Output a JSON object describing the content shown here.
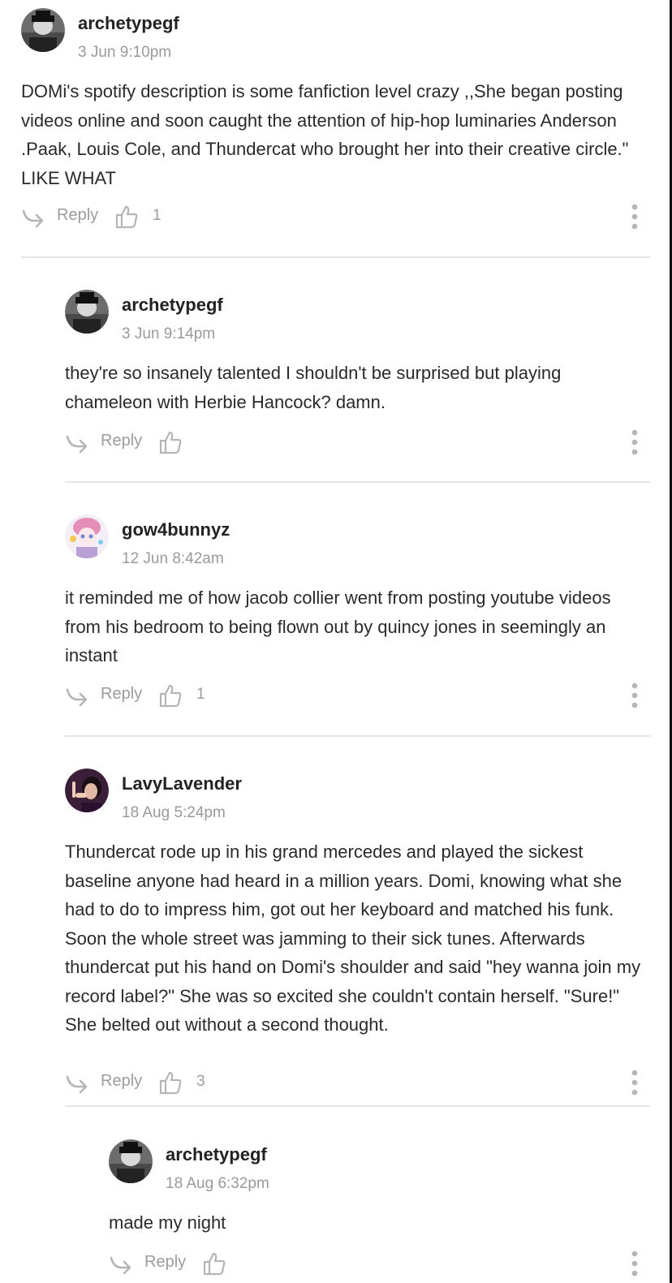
{
  "comments": [
    {
      "username": "archetypegf",
      "timestamp": "3 Jun 9:10pm",
      "body": "DOMi's spotify description is some fanfiction level crazy ,,She began posting videos online and soon caught the attention of hip-hop luminaries Anderson .Paak, Louis Cole, and Thundercat who brought her into their creative circle.\" LIKE WHAT",
      "reply_label": "Reply",
      "like_count": "1",
      "avatar": "archetypegf-avatar"
    },
    {
      "username": "archetypegf",
      "timestamp": "3 Jun 9:14pm",
      "body": "they're so insanely talented I shouldn't be surprised but playing chameleon with Herbie Hancock? damn.",
      "reply_label": "Reply",
      "like_count": "",
      "avatar": "archetypegf-avatar"
    },
    {
      "username": "gow4bunnyz",
      "timestamp": "12 Jun 8:42am",
      "body": "it reminded me of how jacob collier went from posting youtube videos from his bedroom to being flown out by quincy jones in seemingly an instant",
      "reply_label": "Reply",
      "like_count": "1",
      "avatar": "gow4bunnyz-avatar"
    },
    {
      "username": "LavyLavender",
      "timestamp": "18 Aug 5:24pm",
      "body": "Thundercat rode up in his grand mercedes and played the sickest baseline anyone had heard in a million years. Domi, knowing what she had to do to impress him, got out her keyboard and matched his funk. Soon the whole street was jamming to their sick tunes. Afterwards thundercat put his hand on Domi's shoulder and said \"hey wanna join my record label?\" She was so excited she couldn't contain herself. \"Sure!\" She belted out without a second thought.",
      "reply_label": "Reply",
      "like_count": "3",
      "avatar": "lavylavender-avatar"
    },
    {
      "username": "archetypegf",
      "timestamp": "18 Aug 6:32pm",
      "body": "made my night",
      "reply_label": "Reply",
      "like_count": "",
      "avatar": "archetypegf-avatar"
    }
  ],
  "colors": {
    "text": "#2a2a2a",
    "muted": "#9c9c9c",
    "divider": "#e6e6e6",
    "icon": "#b5b5b5"
  },
  "icons": {
    "reply": "reply-arrow-icon",
    "like": "thumbs-up-icon",
    "more": "more-vertical-icon"
  }
}
